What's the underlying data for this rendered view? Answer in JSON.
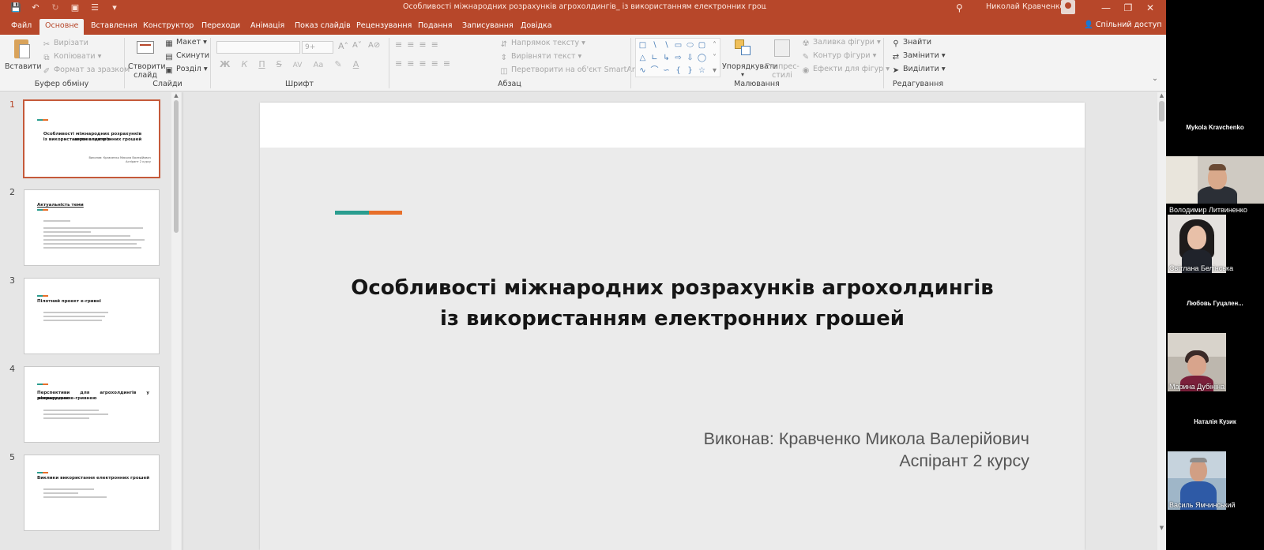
{
  "colors": {
    "accent": "#b7472a",
    "slide_accent_green": "#2a9d8f",
    "slide_accent_orange": "#e76f2a"
  },
  "titlebar": {
    "doc_title": "Особливості міжнародних розрахунків агрохолдингів_ із використанням електронних грошей  -  PowerPoint",
    "user": "Николай Кравченко",
    "qat_icons": [
      "save-icon",
      "undo-icon",
      "redo-icon",
      "present-from-start-icon",
      "touch-mode-icon",
      "customize-qat-icon"
    ],
    "window_buttons": [
      "minimize-icon",
      "restore-icon",
      "close-icon"
    ]
  },
  "tabs": [
    "Файл",
    "Основне",
    "Вставлення",
    "Конструктор",
    "Переходи",
    "Анімація",
    "Показ слайдів",
    "Рецензування",
    "Подання",
    "Записування",
    "Довідка"
  ],
  "active_tab": "Основне",
  "share_label": "Спільний доступ",
  "ribbon": {
    "clipboard": {
      "paste": "Вставити",
      "cut": "Вирізати",
      "copy": "Копіювати",
      "format_painter": "Формат за зразком",
      "label": "Буфер обміну"
    },
    "slides": {
      "new_slide_1": "Створити",
      "new_slide_2": "слайд",
      "layout": "Макет",
      "reset": "Скинути",
      "section": "Розділ",
      "label": "Слайди"
    },
    "font": {
      "font_name": "",
      "font_size": "9+",
      "label": "Шрифт",
      "buttons": [
        "Ж",
        "К",
        "П",
        "S",
        "ab",
        "AV",
        "Aa",
        "A"
      ]
    },
    "paragraph": {
      "text_direction": "Напрямок тексту",
      "align_text": "Вирівняти текст",
      "convert_smartart": "Перетворити на об'єкт SmartArt",
      "label": "Абзац"
    },
    "drawing": {
      "arrange": "Упорядкувати",
      "quick_styles_1": "Експрес-",
      "quick_styles_2": "стилі",
      "shape_fill": "Заливка фігури",
      "shape_outline": "Контур фігури",
      "shape_effects": "Ефекти для фігур",
      "label": "Малювання"
    },
    "editing": {
      "find": "Знайти",
      "replace": "Замінити",
      "select": "Виділити",
      "label": "Редагування"
    }
  },
  "slides_pane": {
    "thumbnails": [
      {
        "num": "1",
        "title_1": "Особливості міжнародних розрахунків агрохолдингів",
        "title_2": "із використанням електронних грошей",
        "sub_1": "Виконав: Кравченко Микола Валерійович",
        "sub_2": "Аспірант 2 курсу"
      },
      {
        "num": "2",
        "title_1": "Актуальність теми",
        "title_2": "",
        "sub_1": "",
        "sub_2": ""
      },
      {
        "num": "3",
        "title_1": "Пілотний проект е-гривні",
        "title_2": "",
        "sub_1": "",
        "sub_2": ""
      },
      {
        "num": "4",
        "title_1": "Перспективи для агрохолдингів у міжнародних",
        "title_2": "розрахунках е-гривнею",
        "sub_1": "",
        "sub_2": ""
      },
      {
        "num": "5",
        "title_1": "Виклики використання електронних грошей",
        "title_2": "",
        "sub_1": "",
        "sub_2": ""
      }
    ]
  },
  "slide": {
    "title_line_1": "Особливості міжнародних розрахунків агрохолдингів",
    "title_line_2": "із використанням електронних грошей",
    "subtitle_line_1": "Виконав: Кравченко Микола Валерійович",
    "subtitle_line_2": "Аспірант 2 курсу"
  },
  "participants": [
    {
      "name": "Mykola Kravchenko",
      "video": false
    },
    {
      "name": "Володимир Литвиненко",
      "video": true
    },
    {
      "name": "Світлана Белінська",
      "video": true
    },
    {
      "name": "Любовь  Гуцален...",
      "video": false
    },
    {
      "name": "Марина Дубініна",
      "video": true
    },
    {
      "name": "Наталія Кузик",
      "video": false
    },
    {
      "name": "Василь Ямчинський",
      "video": true
    }
  ]
}
